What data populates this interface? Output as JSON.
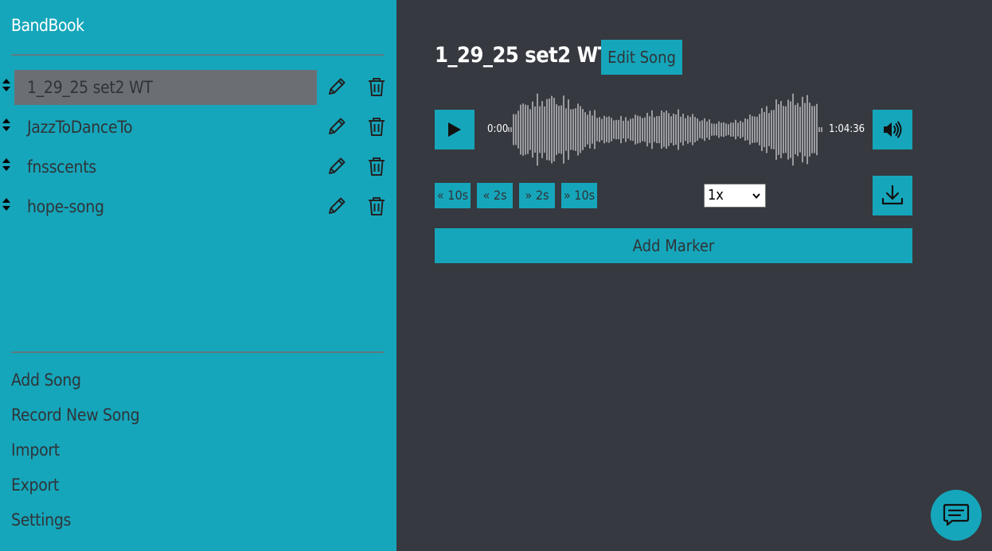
{
  "app": {
    "title": "BandBook"
  },
  "sidebar": {
    "songs": [
      {
        "name": "1_29_25 set2 WT",
        "active": true
      },
      {
        "name": "JazzToDanceTo",
        "active": false
      },
      {
        "name": "fnsscents",
        "active": false
      },
      {
        "name": "hope-song",
        "active": false
      }
    ],
    "menu": [
      "Add Song",
      "Record New Song",
      "Import",
      "Export",
      "Settings"
    ]
  },
  "player": {
    "song_title": "1_29_25 set2 WT",
    "edit_label": "Edit Song",
    "time_current": "0:00",
    "time_total": "1:04:36",
    "skip_labels": [
      "« 10s",
      "« 2s",
      "» 2s",
      "» 10s"
    ],
    "speed_value": "1x",
    "add_marker_label": "Add Marker"
  },
  "colors": {
    "accent": "#16a6bb",
    "main_bg": "#363940",
    "active_row": "#6b6f74",
    "text_dark": "#2f3438"
  },
  "icons": {
    "drag": "sort-icon",
    "edit": "pencil-icon",
    "delete": "trash-icon",
    "play": "play-icon",
    "volume": "volume-icon",
    "download": "download-icon",
    "chat": "chat-icon"
  }
}
